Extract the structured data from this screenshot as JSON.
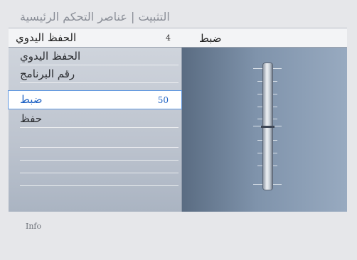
{
  "title": "التثبيت | عناصر التحكم الرئيسية",
  "header": {
    "label": "الحفظ اليدوي",
    "value": "4",
    "right_label": "ضبط"
  },
  "menu": {
    "items": [
      {
        "label": "الحفظ اليدوي",
        "value": ""
      },
      {
        "label": "رقم البرنامج",
        "value": ""
      },
      {
        "label": "ضبط",
        "value": "50"
      },
      {
        "label": "حفظ",
        "value": ""
      }
    ],
    "selected_index": 2
  },
  "slider": {
    "value": 50,
    "max": 100
  },
  "info": "Info",
  "colors": {
    "selected_text": "#1e62c4",
    "selection_border": "#5f97e0"
  }
}
